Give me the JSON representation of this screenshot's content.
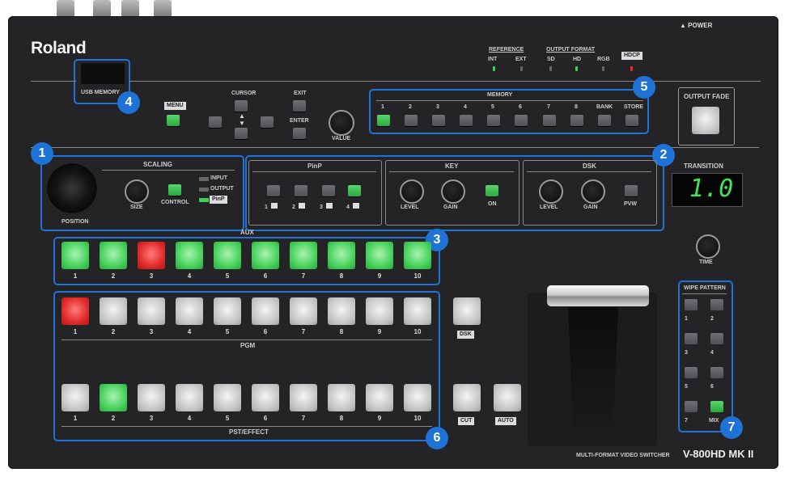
{
  "brand": {
    "logo": "Roland"
  },
  "power": {
    "label": "▲ POWER"
  },
  "usb": {
    "label": "USB MEMORY"
  },
  "menu": {
    "label": "MENU"
  },
  "cursor": {
    "label": "CURSOR"
  },
  "exit": {
    "label": "EXIT"
  },
  "enter": {
    "label": "ENTER"
  },
  "value": {
    "label": "VALUE"
  },
  "reference": {
    "title": "REFERENCE",
    "int": "INT",
    "ext": "EXT"
  },
  "output_format": {
    "title": "OUTPUT FORMAT",
    "sd": "SD",
    "hd": "HD",
    "rgb": "RGB",
    "hdcp": "HDCP"
  },
  "memory": {
    "title": "MEMORY",
    "buttons": [
      "1",
      "2",
      "3",
      "4",
      "5",
      "6",
      "7",
      "8",
      "BANK",
      "STORE"
    ]
  },
  "output_fade": {
    "label": "OUTPUT FADE"
  },
  "scaling": {
    "title": "SCALING",
    "size": "SIZE",
    "control": "CONTROL",
    "input": "INPUT",
    "output": "OUTPUT",
    "pinp": "PinP",
    "position": "POSITION"
  },
  "pinp": {
    "title": "PinP",
    "n1": "1",
    "n2": "2",
    "n3": "3",
    "n4": "4"
  },
  "key": {
    "title": "KEY",
    "level": "LEVEL",
    "gain": "GAIN",
    "on": "ON"
  },
  "dsk": {
    "title": "DSK",
    "level": "LEVEL",
    "gain": "GAIN",
    "pvw": "PVW",
    "button_label": "DSK"
  },
  "transition": {
    "title": "TRANSITION",
    "display": "1.0",
    "time": "TIME"
  },
  "aux": {
    "title": "AUX",
    "buttons": [
      "1",
      "2",
      "3",
      "4",
      "5",
      "6",
      "7",
      "8",
      "9",
      "10"
    ]
  },
  "pgm": {
    "title": "PGM",
    "buttons": [
      "1",
      "2",
      "3",
      "4",
      "5",
      "6",
      "7",
      "8",
      "9",
      "10"
    ]
  },
  "pst": {
    "title": "PST/EFFECT",
    "buttons": [
      "1",
      "2",
      "3",
      "4",
      "5",
      "6",
      "7",
      "8",
      "9",
      "10"
    ]
  },
  "cut": {
    "label": "CUT"
  },
  "auto": {
    "label": "AUTO"
  },
  "wipe": {
    "title": "WIPE PATTERN",
    "n1": "1",
    "n2": "2",
    "n3": "3",
    "n4": "4",
    "n5": "5",
    "n6": "6",
    "n7": "7",
    "mix": "MIX"
  },
  "model": {
    "caption": "MULTI-FORMAT VIDEO SWITCHER",
    "name": "V-800HD MK II"
  },
  "callouts": {
    "c1": "1",
    "c2": "2",
    "c3": "3",
    "c4": "4",
    "c5": "5",
    "c6": "6",
    "c7": "7"
  },
  "colors": {
    "accent": "#1f73d6",
    "led_green": "#3fd25a",
    "button_red": "#e22c2c",
    "panel": "#242426"
  }
}
